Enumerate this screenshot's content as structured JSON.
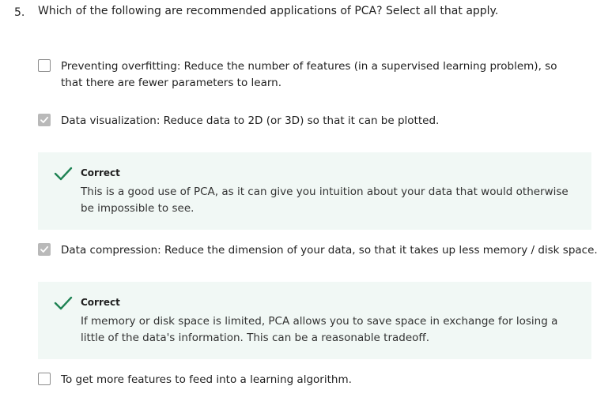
{
  "question": {
    "number": "5.",
    "text": "Which of the following are recommended applications of PCA? Select all that apply."
  },
  "options": [
    {
      "label": "Preventing overfitting: Reduce the number of features (in a supervised learning problem), so that there are fewer parameters to learn.",
      "checked": false
    },
    {
      "label": "Data visualization: Reduce data to 2D (or 3D) so that it can be plotted.",
      "checked": true,
      "feedback": {
        "title": "Correct",
        "text": "This is a good use of PCA, as it can give you intuition about your data that would otherwise be impossible to see."
      }
    },
    {
      "label": "Data compression: Reduce the dimension of your data, so that it takes up less memory / disk space.",
      "checked": true,
      "feedback": {
        "title": "Correct",
        "text": "If memory or disk space is limited, PCA allows you to save space in exchange for losing a little of the data's information. This can be a reasonable tradeoff."
      }
    },
    {
      "label": "To get more features to feed into a learning algorithm.",
      "checked": false
    }
  ],
  "icons": {
    "correct": "checkmark-icon",
    "checked_box": "checkbox-checked-icon"
  },
  "colors": {
    "correct_green": "#1f8354",
    "feedback_bg": "#f1f8f5",
    "checked_box": "#b9b9b9"
  }
}
